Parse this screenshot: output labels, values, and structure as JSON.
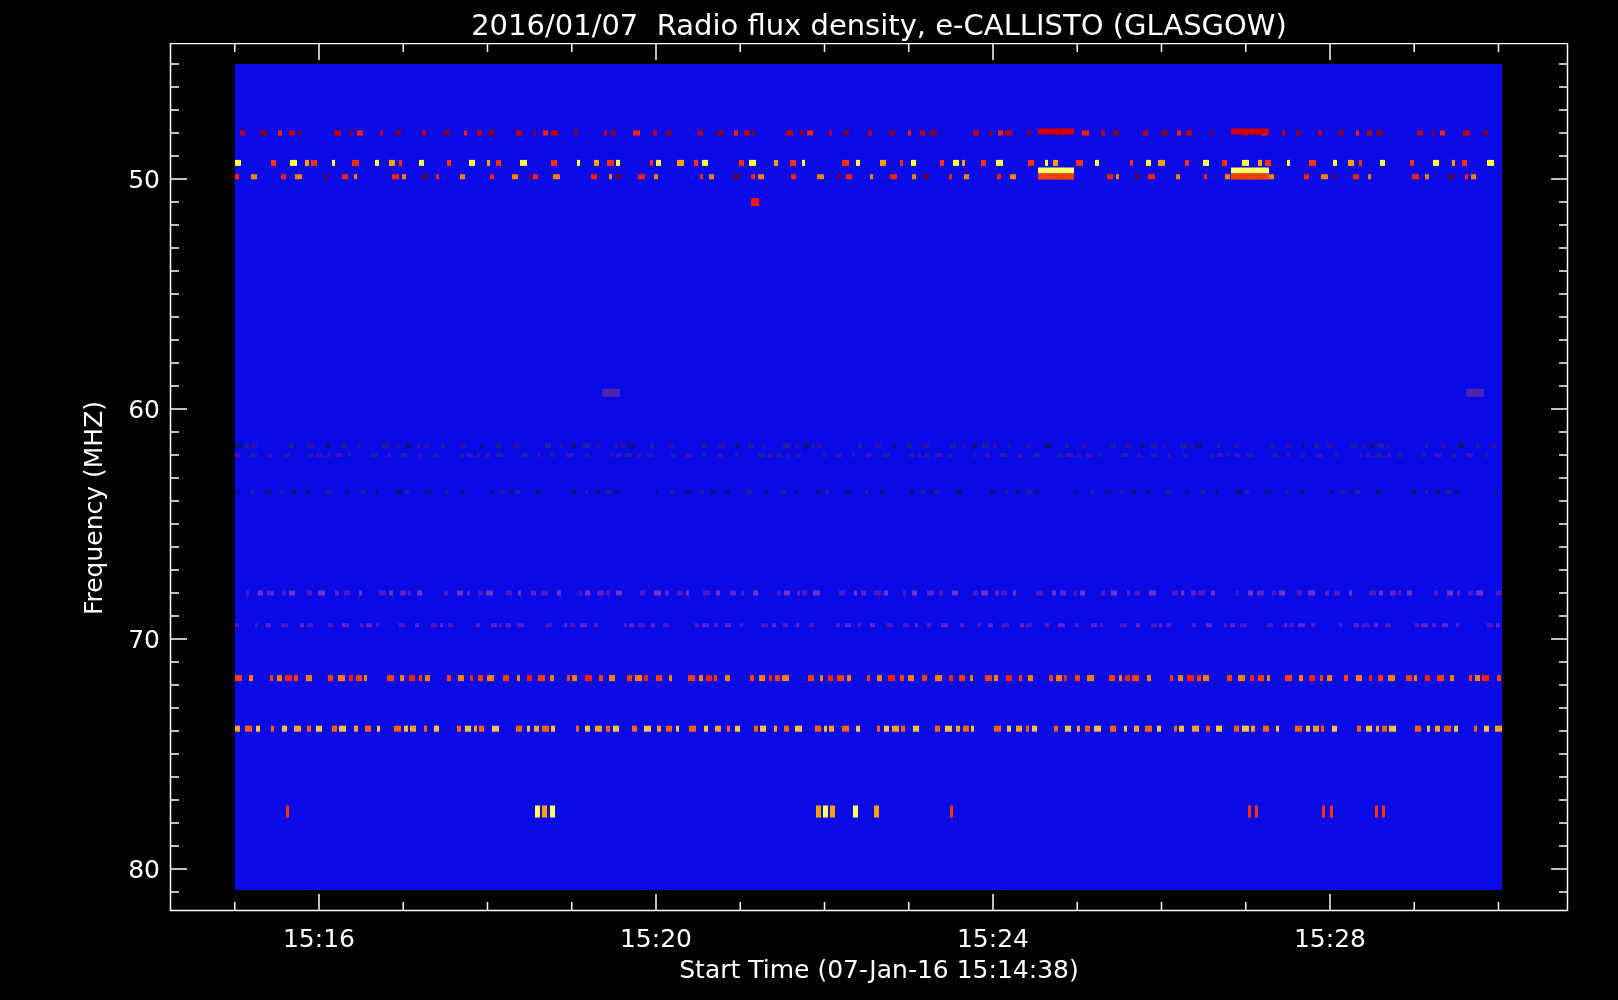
{
  "title": "2016/01/07  Radio flux density, e-CALLISTO (GLASGOW)",
  "plot": {
    "ylabel": "Frequency (MHZ)",
    "xlabel": "Start Time (07-Jan-16 15:14:38)",
    "yticks": [
      "50",
      "60",
      "70",
      "80"
    ],
    "xticks": [
      "15:16",
      "15:20",
      "15:24",
      "15:28"
    ]
  }
}
